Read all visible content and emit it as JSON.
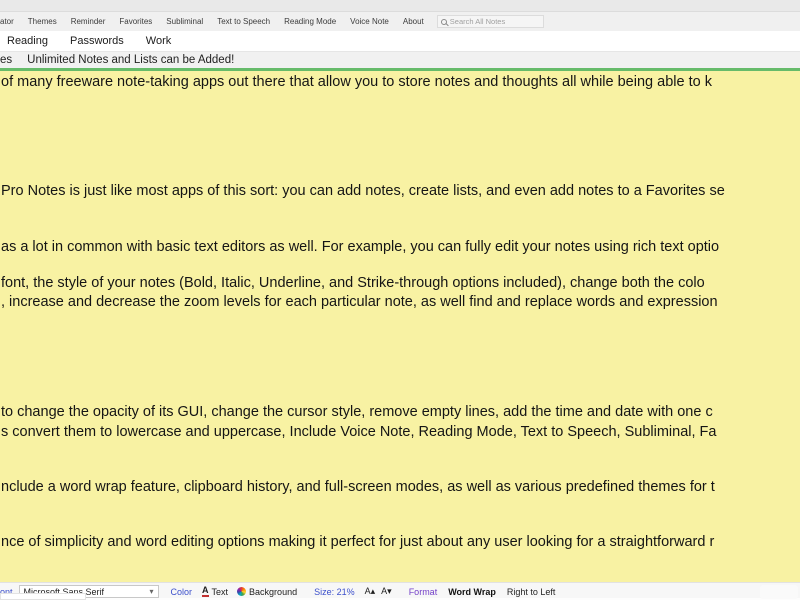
{
  "menu_bar": {
    "items": [
      "ator",
      "Themes",
      "Reminder",
      "Favorites",
      "Subliminal",
      "Text to Speech",
      "Reading Mode",
      "Voice Note",
      "About"
    ],
    "search": {
      "placeholder": "Search All Notes"
    }
  },
  "tab_bar": {
    "tabs": [
      "Reading",
      "Passwords",
      "Work"
    ]
  },
  "info_bar": {
    "left_fragment": "es",
    "message": "Unlimited Notes and Lists can be Added!"
  },
  "editor": {
    "background_color": "#f8f2a3",
    "divider_color": "#66bb6a",
    "lines": [
      "of many freeware note-taking apps out there that allow you to store notes and thoughts all while being able to k",
      "Pro Notes is just like most apps of this sort: you can add notes, create lists, and even add notes to a Favorites se",
      "as a lot in common with basic text editors as well. For example, you can fully edit your notes using rich text optio",
      "font, the style of your notes (Bold, Italic, Underline, and Strike-through options included), change both the colo",
      ", increase and decrease the zoom levels for each particular note, as well find and replace words and expression",
      "to change the opacity of its GUI, change the cursor style, remove empty lines, add the time and date with one c",
      "s convert them to lowercase and uppercase, Include Voice Note, Reading Mode, Text to Speech, Subliminal, Fa",
      "nclude a word wrap feature, clipboard history, and full-screen modes, as well as various predefined themes for t",
      "nce of simplicity and word editing options making it perfect for just about any user looking for a straightforward r"
    ]
  },
  "toolbar": {
    "font_label": "ont",
    "font_family": "Microsoft Sans Serif",
    "color_label": "Color",
    "text_label": "Text",
    "background_label": "Background",
    "size_label": "Size: 21%",
    "increase_font_glyph": "A▴",
    "decrease_font_glyph": "A▾",
    "format_label": "Format",
    "word_wrap_label": "Word Wrap",
    "right_to_left_label": "Right to Left",
    "accent_blue": "#3c50cc",
    "accent_purple": "#7440c8"
  },
  "icons": {
    "chevron_down": "▾",
    "text_color_glyph": "A"
  }
}
